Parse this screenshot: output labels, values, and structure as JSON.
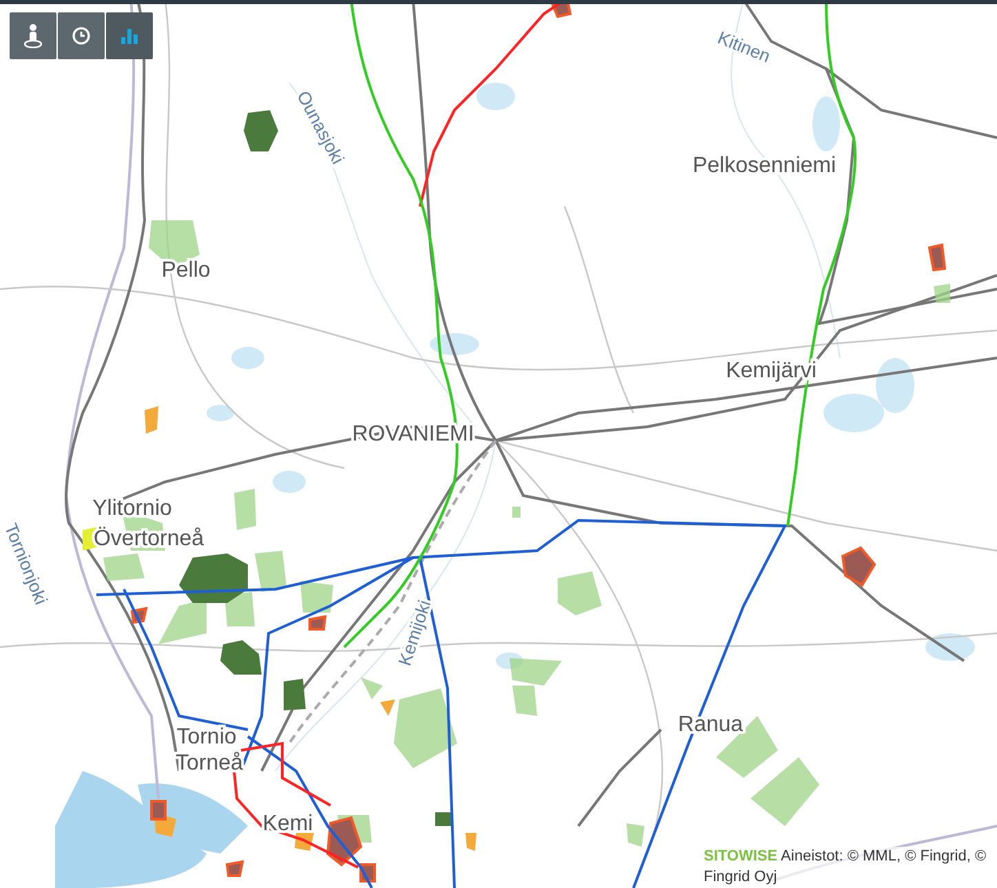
{
  "toolbar": [
    {
      "kind": "person",
      "selected": false
    },
    {
      "kind": "clock",
      "selected": false
    },
    {
      "kind": "chart",
      "selected": true
    }
  ],
  "labels": [
    {
      "text": "Kitinen",
      "kind": "river"
    },
    {
      "text": "Ounasjoki",
      "kind": "river"
    },
    {
      "text": "Pelkosenniemi",
      "kind": "town"
    },
    {
      "text": "Pello",
      "kind": "town"
    },
    {
      "text": "Kemijärvi",
      "kind": "town"
    },
    {
      "text": "ROVANIEMI",
      "kind": "city"
    },
    {
      "text": "Ylitornio",
      "kind": "town"
    },
    {
      "text": "Övertorneå",
      "kind": "town"
    },
    {
      "text": "Tornionjoki",
      "kind": "river"
    },
    {
      "text": "Kemijoki",
      "kind": "river"
    },
    {
      "text": "Ranua",
      "kind": "town"
    },
    {
      "text": "Tornio",
      "kind": "town"
    },
    {
      "text": "Torneå",
      "kind": "town"
    },
    {
      "text": "Kemi",
      "kind": "town"
    }
  ],
  "attribution": {
    "logo": "SITOWISE",
    "text": "Aineistot: © MML, © Fingrid, © Fingrid Oyj"
  }
}
